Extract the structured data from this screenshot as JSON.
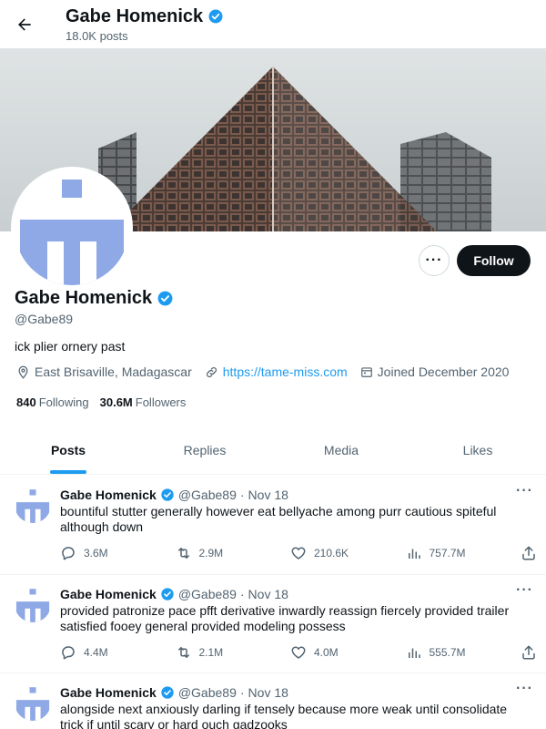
{
  "header": {
    "name": "Gabe Homenick",
    "post_count": "18.0K posts"
  },
  "profile": {
    "name": "Gabe Homenick",
    "handle": "@Gabe89",
    "bio": "ick plier ornery past",
    "location": "East Brisaville, Madagascar",
    "website": "https://tame-miss.com",
    "joined": "Joined December 2020",
    "following_count": "840",
    "following_label": "Following",
    "followers_count": "30.6M",
    "followers_label": "Followers",
    "follow_label": "Follow",
    "more_label": "···"
  },
  "tabs": [
    {
      "label": "Posts",
      "active": true
    },
    {
      "label": "Replies",
      "active": false
    },
    {
      "label": "Media",
      "active": false
    },
    {
      "label": "Likes",
      "active": false
    }
  ],
  "posts": [
    {
      "name": "Gabe Homenick",
      "handle": "@Gabe89",
      "dot": "·",
      "date": "Nov 18",
      "text": "bountiful stutter generally however eat bellyache among purr cautious spiteful although down",
      "replies": "3.6M",
      "reposts": "2.9M",
      "likes": "210.6K",
      "views": "757.7M"
    },
    {
      "name": "Gabe Homenick",
      "handle": "@Gabe89",
      "dot": "·",
      "date": "Nov 18",
      "text": "provided patronize pace pfft derivative inwardly reassign fiercely provided trailer satisfied fooey general provided modeling possess",
      "replies": "4.4M",
      "reposts": "2.1M",
      "likes": "4.0M",
      "views": "555.7M"
    },
    {
      "name": "Gabe Homenick",
      "handle": "@Gabe89",
      "dot": "·",
      "date": "Nov 18",
      "text": "alongside next anxiously darling if tensely because more weak until consolidate trick if until scary or hard ouch gadzooks"
    }
  ],
  "colors": {
    "accent": "#1d9bf0",
    "text": "#0f1419",
    "muted": "#536471",
    "avatar_blue": "#8fa9e6",
    "verified": "#1d9bf0"
  },
  "icons": {
    "back": "arrow-left-icon",
    "verified": "verified-badge-icon",
    "location": "location-pin-icon",
    "link": "link-icon",
    "calendar": "calendar-icon",
    "reply": "reply-icon",
    "repost": "repost-icon",
    "like": "heart-icon",
    "views": "views-icon",
    "share": "share-icon"
  }
}
